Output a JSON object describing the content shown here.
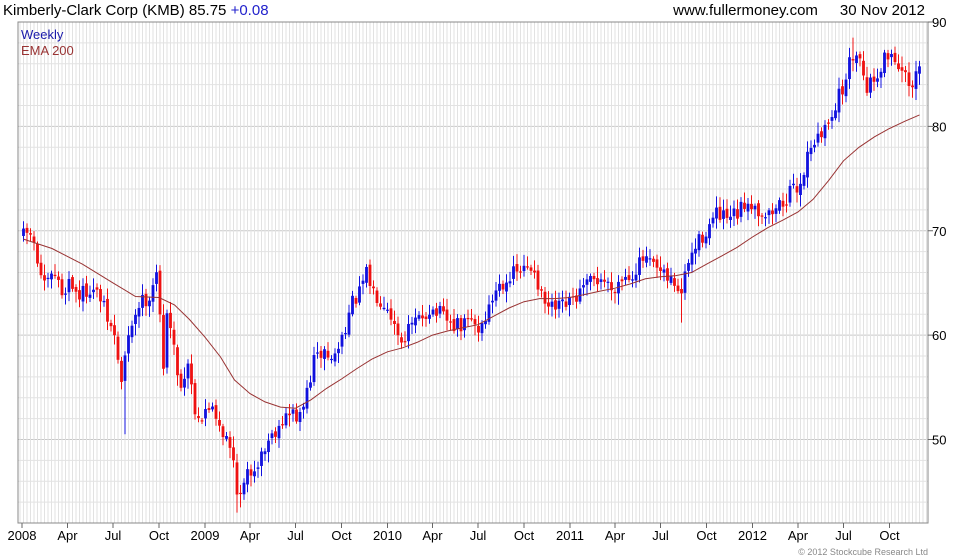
{
  "header": {
    "name": "Kimberly-Clark Corp (KMB)",
    "price": "85.75",
    "change": "+0.08",
    "website": "www.fullermoney.com",
    "date": "30 Nov 2012"
  },
  "copyright": "© 2012 Stockcube Research Ltd",
  "colors": {
    "up": "#1010dd",
    "down": "#ee1111",
    "ema": "#993333",
    "grid": "#e2e2e2",
    "frame": "#888888",
    "legend_weekly": "#1a1aaa",
    "legend_ema": "#993333"
  },
  "chart_data": {
    "type": "candlestick",
    "legend": [
      {
        "label": "Weekly",
        "color": "#1a1aaa"
      },
      {
        "label": "EMA 200",
        "color": "#993333"
      }
    ],
    "y_axis": {
      "side": "right",
      "range": [
        42,
        90
      ],
      "ticks": [
        50,
        60,
        70,
        80,
        90
      ]
    },
    "x_axis": {
      "range": [
        "2007-12-24",
        "2012-12-17"
      ],
      "ticks": [
        {
          "date": "2008-01-01",
          "label": "2008"
        },
        {
          "date": "2008-04-01",
          "label": "Apr"
        },
        {
          "date": "2008-07-01",
          "label": "Jul"
        },
        {
          "date": "2008-10-01",
          "label": "Oct"
        },
        {
          "date": "2009-01-01",
          "label": "2009"
        },
        {
          "date": "2009-04-01",
          "label": "Apr"
        },
        {
          "date": "2009-07-01",
          "label": "Jul"
        },
        {
          "date": "2009-10-01",
          "label": "Oct"
        },
        {
          "date": "2010-01-01",
          "label": "2010"
        },
        {
          "date": "2010-04-01",
          "label": "Apr"
        },
        {
          "date": "2010-07-01",
          "label": "Jul"
        },
        {
          "date": "2010-10-01",
          "label": "Oct"
        },
        {
          "date": "2011-01-01",
          "label": "2011"
        },
        {
          "date": "2011-04-01",
          "label": "Apr"
        },
        {
          "date": "2011-07-01",
          "label": "Jul"
        },
        {
          "date": "2011-10-01",
          "label": "Oct"
        },
        {
          "date": "2012-01-01",
          "label": "2012"
        },
        {
          "date": "2012-04-01",
          "label": "Apr"
        },
        {
          "date": "2012-07-01",
          "label": "Jul"
        },
        {
          "date": "2012-10-01",
          "label": "Oct"
        }
      ]
    },
    "close_path": [
      [
        "2008-01-04",
        69.5
      ],
      [
        "2008-01-18",
        69.8
      ],
      [
        "2008-02-01",
        67.0
      ],
      [
        "2008-02-15",
        64.5
      ],
      [
        "2008-03-07",
        65.8
      ],
      [
        "2008-03-21",
        64.0
      ],
      [
        "2008-04-04",
        65.2
      ],
      [
        "2008-04-25",
        63.8
      ],
      [
        "2008-05-16",
        64.6
      ],
      [
        "2008-06-06",
        63.5
      ],
      [
        "2008-06-20",
        61.5
      ],
      [
        "2008-07-04",
        59.8
      ],
      [
        "2008-07-18",
        55.5
      ],
      [
        "2008-07-25",
        57.8
      ],
      [
        "2008-08-08",
        61.2
      ],
      [
        "2008-08-22",
        63.0
      ],
      [
        "2008-09-12",
        63.8
      ],
      [
        "2008-09-26",
        66.3
      ],
      [
        "2008-10-10",
        56.5
      ],
      [
        "2008-10-17",
        62.8
      ],
      [
        "2008-10-31",
        58.5
      ],
      [
        "2008-11-14",
        55.0
      ],
      [
        "2008-11-28",
        57.5
      ],
      [
        "2008-12-12",
        53.0
      ],
      [
        "2008-12-26",
        52.0
      ],
      [
        "2009-01-16",
        53.5
      ],
      [
        "2009-01-30",
        51.5
      ],
      [
        "2009-02-13",
        50.0
      ],
      [
        "2009-02-27",
        48.0
      ],
      [
        "2009-03-06",
        45.5
      ],
      [
        "2009-03-13",
        44.5
      ],
      [
        "2009-03-27",
        46.5
      ],
      [
        "2009-04-10",
        47.5
      ],
      [
        "2009-04-24",
        48.5
      ],
      [
        "2009-05-08",
        50.0
      ],
      [
        "2009-05-22",
        51.0
      ],
      [
        "2009-06-05",
        52.0
      ],
      [
        "2009-06-26",
        52.5
      ],
      [
        "2009-07-10",
        52.0
      ],
      [
        "2009-07-24",
        54.5
      ],
      [
        "2009-08-07",
        57.5
      ],
      [
        "2009-08-28",
        58.5
      ],
      [
        "2009-09-11",
        57.5
      ],
      [
        "2009-09-25",
        58.8
      ],
      [
        "2009-10-09",
        61.0
      ],
      [
        "2009-10-23",
        63.0
      ],
      [
        "2009-11-06",
        64.0
      ],
      [
        "2009-11-20",
        65.8
      ],
      [
        "2009-12-04",
        64.2
      ],
      [
        "2009-12-18",
        63.5
      ],
      [
        "2010-01-01",
        63.0
      ],
      [
        "2010-01-15",
        61.0
      ],
      [
        "2010-01-29",
        59.5
      ],
      [
        "2010-02-12",
        60.5
      ],
      [
        "2010-03-05",
        61.5
      ],
      [
        "2010-03-26",
        62.5
      ],
      [
        "2010-04-16",
        62.0
      ],
      [
        "2010-05-07",
        61.0
      ],
      [
        "2010-05-28",
        60.8
      ],
      [
        "2010-06-18",
        61.5
      ],
      [
        "2010-07-02",
        60.5
      ],
      [
        "2010-07-23",
        62.5
      ],
      [
        "2010-08-06",
        64.5
      ],
      [
        "2010-08-27",
        65.5
      ],
      [
        "2010-09-17",
        66.0
      ],
      [
        "2010-10-08",
        66.3
      ],
      [
        "2010-10-22",
        66.5
      ],
      [
        "2010-11-05",
        63.5
      ],
      [
        "2010-11-19",
        62.5
      ],
      [
        "2010-12-10",
        62.5
      ],
      [
        "2010-12-31",
        63.0
      ],
      [
        "2011-01-21",
        64.0
      ],
      [
        "2011-02-11",
        65.0
      ],
      [
        "2011-03-04",
        65.5
      ],
      [
        "2011-03-25",
        64.5
      ],
      [
        "2011-04-15",
        65.5
      ],
      [
        "2011-05-06",
        66.0
      ],
      [
        "2011-05-27",
        67.2
      ],
      [
        "2011-06-17",
        66.5
      ],
      [
        "2011-07-08",
        65.5
      ],
      [
        "2011-07-29",
        65.0
      ],
      [
        "2011-08-12",
        64.0
      ],
      [
        "2011-08-26",
        67.0
      ],
      [
        "2011-09-16",
        69.0
      ],
      [
        "2011-10-07",
        70.5
      ],
      [
        "2011-10-21",
        71.5
      ],
      [
        "2011-11-11",
        71.0
      ],
      [
        "2011-12-02",
        71.5
      ],
      [
        "2011-12-23",
        73.0
      ],
      [
        "2012-01-13",
        72.0
      ],
      [
        "2012-02-03",
        71.5
      ],
      [
        "2012-02-24",
        72.5
      ],
      [
        "2012-03-16",
        73.5
      ],
      [
        "2012-04-06",
        74.5
      ],
      [
        "2012-04-27",
        78.5
      ],
      [
        "2012-05-18",
        79.0
      ],
      [
        "2012-06-08",
        81.5
      ],
      [
        "2012-06-29",
        83.5
      ],
      [
        "2012-07-13",
        86.0
      ],
      [
        "2012-07-27",
        87.5
      ],
      [
        "2012-08-17",
        84.0
      ],
      [
        "2012-08-31",
        84.5
      ],
      [
        "2012-09-21",
        86.5
      ],
      [
        "2012-10-05",
        87.0
      ],
      [
        "2012-10-19",
        86.0
      ],
      [
        "2012-11-02",
        84.5
      ],
      [
        "2012-11-16",
        83.0
      ],
      [
        "2012-11-23",
        85.0
      ],
      [
        "2012-11-30",
        85.75
      ]
    ],
    "ema200": [
      [
        "2008-01-04",
        69.2
      ],
      [
        "2008-03-01",
        68.3
      ],
      [
        "2008-05-01",
        66.8
      ],
      [
        "2008-07-01",
        65.0
      ],
      [
        "2008-08-15",
        63.7
      ],
      [
        "2008-10-01",
        63.6
      ],
      [
        "2008-11-01",
        62.9
      ],
      [
        "2008-12-01",
        61.5
      ],
      [
        "2009-01-01",
        59.8
      ],
      [
        "2009-02-01",
        57.9
      ],
      [
        "2009-03-01",
        55.7
      ],
      [
        "2009-04-01",
        54.4
      ],
      [
        "2009-05-01",
        53.6
      ],
      [
        "2009-06-01",
        53.1
      ],
      [
        "2009-07-01",
        53.0
      ],
      [
        "2009-08-01",
        53.8
      ],
      [
        "2009-09-01",
        54.9
      ],
      [
        "2009-10-01",
        55.8
      ],
      [
        "2009-11-01",
        56.8
      ],
      [
        "2009-12-01",
        57.7
      ],
      [
        "2010-01-01",
        58.4
      ],
      [
        "2010-02-01",
        58.8
      ],
      [
        "2010-03-01",
        59.3
      ],
      [
        "2010-04-01",
        60.0
      ],
      [
        "2010-05-01",
        60.4
      ],
      [
        "2010-06-01",
        60.7
      ],
      [
        "2010-07-01",
        61.0
      ],
      [
        "2010-08-01",
        61.8
      ],
      [
        "2010-09-01",
        62.6
      ],
      [
        "2010-10-01",
        63.2
      ],
      [
        "2010-11-01",
        63.5
      ],
      [
        "2010-12-01",
        63.5
      ],
      [
        "2011-01-01",
        63.6
      ],
      [
        "2011-02-01",
        63.9
      ],
      [
        "2011-03-01",
        64.2
      ],
      [
        "2011-04-01",
        64.5
      ],
      [
        "2011-05-01",
        64.9
      ],
      [
        "2011-06-01",
        65.4
      ],
      [
        "2011-07-01",
        65.6
      ],
      [
        "2011-08-01",
        65.7
      ],
      [
        "2011-09-01",
        66.0
      ],
      [
        "2011-10-01",
        66.8
      ],
      [
        "2011-11-01",
        67.6
      ],
      [
        "2011-12-01",
        68.4
      ],
      [
        "2012-01-01",
        69.4
      ],
      [
        "2012-02-01",
        70.3
      ],
      [
        "2012-03-01",
        71.0
      ],
      [
        "2012-04-01",
        71.8
      ],
      [
        "2012-05-01",
        73.0
      ],
      [
        "2012-06-01",
        74.8
      ],
      [
        "2012-07-01",
        76.7
      ],
      [
        "2012-08-01",
        78.0
      ],
      [
        "2012-09-01",
        79.0
      ],
      [
        "2012-10-01",
        79.8
      ],
      [
        "2012-11-01",
        80.5
      ],
      [
        "2012-11-30",
        81.1
      ]
    ],
    "anomalies": [
      {
        "date": "2008-07-25",
        "low": 50.5
      },
      {
        "date": "2008-07-18",
        "low": 54.8
      },
      {
        "date": "2009-03-06",
        "low": 43.0
      },
      {
        "date": "2009-03-13",
        "low": 43.5
      },
      {
        "date": "2011-08-12",
        "low": 61.2
      },
      {
        "date": "2012-07-20",
        "high": 88.5
      }
    ]
  }
}
